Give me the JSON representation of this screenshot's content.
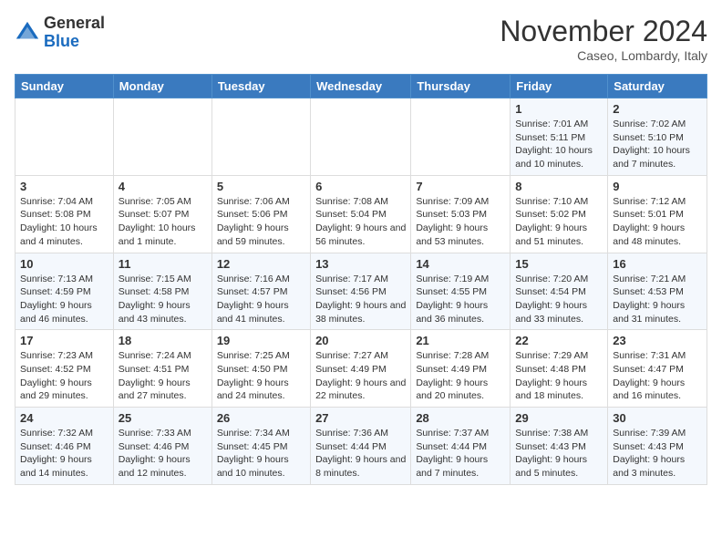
{
  "header": {
    "logo": {
      "general": "General",
      "blue": "Blue"
    },
    "month": "November 2024",
    "location": "Caseo, Lombardy, Italy"
  },
  "weekdays": [
    "Sunday",
    "Monday",
    "Tuesday",
    "Wednesday",
    "Thursday",
    "Friday",
    "Saturday"
  ],
  "weeks": [
    [
      null,
      null,
      null,
      null,
      null,
      {
        "day": 1,
        "sunrise": "7:01 AM",
        "sunset": "5:11 PM",
        "daylight": "10 hours and 10 minutes."
      },
      {
        "day": 2,
        "sunrise": "7:02 AM",
        "sunset": "5:10 PM",
        "daylight": "10 hours and 7 minutes."
      }
    ],
    [
      {
        "day": 3,
        "sunrise": "7:04 AM",
        "sunset": "5:08 PM",
        "daylight": "10 hours and 4 minutes."
      },
      {
        "day": 4,
        "sunrise": "7:05 AM",
        "sunset": "5:07 PM",
        "daylight": "10 hours and 1 minute."
      },
      {
        "day": 5,
        "sunrise": "7:06 AM",
        "sunset": "5:06 PM",
        "daylight": "9 hours and 59 minutes."
      },
      {
        "day": 6,
        "sunrise": "7:08 AM",
        "sunset": "5:04 PM",
        "daylight": "9 hours and 56 minutes."
      },
      {
        "day": 7,
        "sunrise": "7:09 AM",
        "sunset": "5:03 PM",
        "daylight": "9 hours and 53 minutes."
      },
      {
        "day": 8,
        "sunrise": "7:10 AM",
        "sunset": "5:02 PM",
        "daylight": "9 hours and 51 minutes."
      },
      {
        "day": 9,
        "sunrise": "7:12 AM",
        "sunset": "5:01 PM",
        "daylight": "9 hours and 48 minutes."
      }
    ],
    [
      {
        "day": 10,
        "sunrise": "7:13 AM",
        "sunset": "4:59 PM",
        "daylight": "9 hours and 46 minutes."
      },
      {
        "day": 11,
        "sunrise": "7:15 AM",
        "sunset": "4:58 PM",
        "daylight": "9 hours and 43 minutes."
      },
      {
        "day": 12,
        "sunrise": "7:16 AM",
        "sunset": "4:57 PM",
        "daylight": "9 hours and 41 minutes."
      },
      {
        "day": 13,
        "sunrise": "7:17 AM",
        "sunset": "4:56 PM",
        "daylight": "9 hours and 38 minutes."
      },
      {
        "day": 14,
        "sunrise": "7:19 AM",
        "sunset": "4:55 PM",
        "daylight": "9 hours and 36 minutes."
      },
      {
        "day": 15,
        "sunrise": "7:20 AM",
        "sunset": "4:54 PM",
        "daylight": "9 hours and 33 minutes."
      },
      {
        "day": 16,
        "sunrise": "7:21 AM",
        "sunset": "4:53 PM",
        "daylight": "9 hours and 31 minutes."
      }
    ],
    [
      {
        "day": 17,
        "sunrise": "7:23 AM",
        "sunset": "4:52 PM",
        "daylight": "9 hours and 29 minutes."
      },
      {
        "day": 18,
        "sunrise": "7:24 AM",
        "sunset": "4:51 PM",
        "daylight": "9 hours and 27 minutes."
      },
      {
        "day": 19,
        "sunrise": "7:25 AM",
        "sunset": "4:50 PM",
        "daylight": "9 hours and 24 minutes."
      },
      {
        "day": 20,
        "sunrise": "7:27 AM",
        "sunset": "4:49 PM",
        "daylight": "9 hours and 22 minutes."
      },
      {
        "day": 21,
        "sunrise": "7:28 AM",
        "sunset": "4:49 PM",
        "daylight": "9 hours and 20 minutes."
      },
      {
        "day": 22,
        "sunrise": "7:29 AM",
        "sunset": "4:48 PM",
        "daylight": "9 hours and 18 minutes."
      },
      {
        "day": 23,
        "sunrise": "7:31 AM",
        "sunset": "4:47 PM",
        "daylight": "9 hours and 16 minutes."
      }
    ],
    [
      {
        "day": 24,
        "sunrise": "7:32 AM",
        "sunset": "4:46 PM",
        "daylight": "9 hours and 14 minutes."
      },
      {
        "day": 25,
        "sunrise": "7:33 AM",
        "sunset": "4:46 PM",
        "daylight": "9 hours and 12 minutes."
      },
      {
        "day": 26,
        "sunrise": "7:34 AM",
        "sunset": "4:45 PM",
        "daylight": "9 hours and 10 minutes."
      },
      {
        "day": 27,
        "sunrise": "7:36 AM",
        "sunset": "4:44 PM",
        "daylight": "9 hours and 8 minutes."
      },
      {
        "day": 28,
        "sunrise": "7:37 AM",
        "sunset": "4:44 PM",
        "daylight": "9 hours and 7 minutes."
      },
      {
        "day": 29,
        "sunrise": "7:38 AM",
        "sunset": "4:43 PM",
        "daylight": "9 hours and 5 minutes."
      },
      {
        "day": 30,
        "sunrise": "7:39 AM",
        "sunset": "4:43 PM",
        "daylight": "9 hours and 3 minutes."
      }
    ]
  ]
}
